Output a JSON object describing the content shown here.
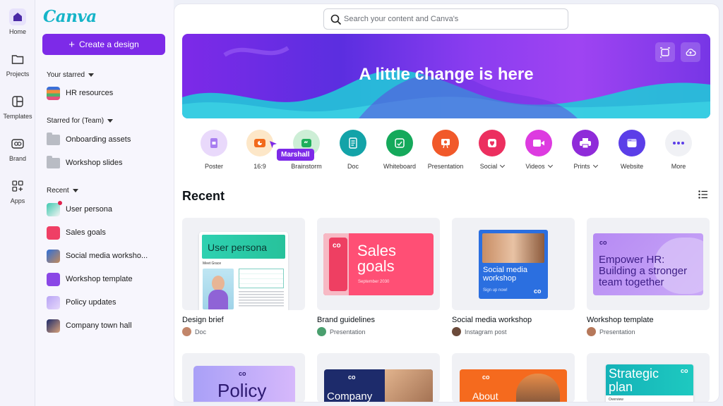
{
  "rail": [
    {
      "label": "Home",
      "icon": "home-icon"
    },
    {
      "label": "Projects",
      "icon": "folder-icon"
    },
    {
      "label": "Templates",
      "icon": "templates-icon"
    },
    {
      "label": "Brand",
      "icon": "brand-icon"
    },
    {
      "label": "Apps",
      "icon": "apps-icon"
    }
  ],
  "logo": "Canva",
  "create_label": "Create a design",
  "starred": {
    "heading": "Your starred",
    "items": [
      {
        "label": "HR resources"
      }
    ]
  },
  "team": {
    "heading": "Starred for (Team)",
    "items": [
      {
        "label": "Onboarding assets"
      },
      {
        "label": "Workshop slides"
      }
    ]
  },
  "recent_side": {
    "heading": "Recent",
    "items": [
      {
        "label": "User persona"
      },
      {
        "label": "Sales goals"
      },
      {
        "label": "Social media worksho..."
      },
      {
        "label": "Workshop template"
      },
      {
        "label": "Policy updates"
      },
      {
        "label": "Company town hall"
      }
    ]
  },
  "search": {
    "placeholder": "Search your content and Canva's"
  },
  "banner": {
    "title": "A little change is here"
  },
  "categories": [
    {
      "label": "Poster",
      "color": "#e9d9fb",
      "icon": "poster-icon"
    },
    {
      "label": "16:9",
      "color": "#fde7c8",
      "icon": "presentation-16-9-icon"
    },
    {
      "label": "Brainstorm",
      "color": "#cdeed6",
      "icon": "brainstorm-icon"
    },
    {
      "label": "Doc",
      "color": "#13a3a8",
      "icon": "doc-icon"
    },
    {
      "label": "Whiteboard",
      "color": "#15a95b",
      "icon": "whiteboard-icon"
    },
    {
      "label": "Presentation",
      "color": "#f1592a",
      "icon": "presentation-icon"
    },
    {
      "label": "Social",
      "color": "#ec2f5f",
      "icon": "social-icon",
      "dropdown": true
    },
    {
      "label": "Videos",
      "color": "#dd3be0",
      "icon": "video-icon",
      "dropdown": true
    },
    {
      "label": "Prints",
      "color": "#8f2bd9",
      "icon": "print-icon",
      "dropdown": true
    },
    {
      "label": "Website",
      "color": "#5b3ee8",
      "icon": "website-icon"
    },
    {
      "label": "More",
      "color": "#f0f1f5",
      "icon": "more-icon"
    }
  ],
  "tooltip": "Marshall",
  "recent": {
    "title": "Recent",
    "cards": [
      {
        "title": "Design brief",
        "type": "Doc",
        "art_title": "User persona",
        "art_sub": "Meet Grace"
      },
      {
        "title": "Brand guidelines",
        "type": "Presentation",
        "art_title_1": "Sales",
        "art_title_2": "goals",
        "art_sub": "September 2030"
      },
      {
        "title": "Social media workshop",
        "type": "Instagram post",
        "art_title_1": "Social media",
        "art_title_2": "workshop",
        "art_sub": "Sign up now!"
      },
      {
        "title": "Workshop template",
        "type": "Presentation",
        "art_title_1": "Empower HR:",
        "art_title_2": "Building a stronger",
        "art_title_3": "team together"
      }
    ],
    "bottom": [
      {
        "art_title": "Policy"
      },
      {
        "art_title": "Company"
      },
      {
        "art_title": "About"
      },
      {
        "art_title_1": "Strategic",
        "art_title_2": "plan",
        "art_sub": "Overview"
      }
    ]
  },
  "colors": {
    "brand_purple": "#7d2ae8",
    "logo_teal": "#16b4c8"
  }
}
